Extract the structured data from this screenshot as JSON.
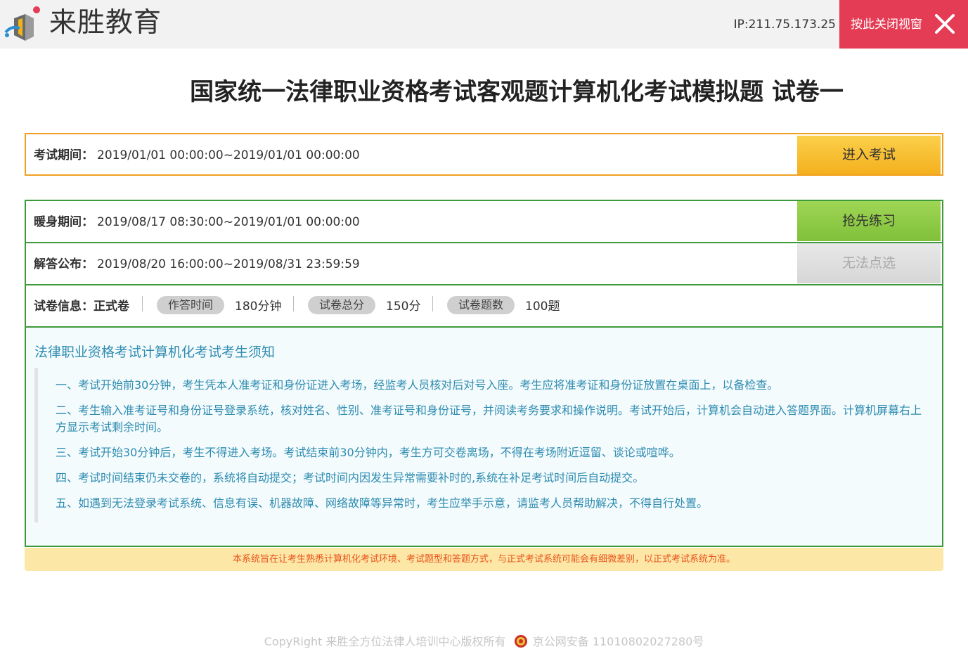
{
  "header": {
    "brand": "来胜教育",
    "ip": "IP:211.75.173.25",
    "close_label": "按此关闭视窗"
  },
  "title": "国家统一法律职业资格考试客观题计算机化考试模拟题 试卷一",
  "exam": {
    "label": "考试期间：",
    "value": "2019/01/01 00:00:00~2019/01/01 00:00:00",
    "button": "进入考试"
  },
  "warmup": {
    "label": "暖身期间：",
    "value": "2019/08/17 08:30:00~2019/01/01 00:00:00",
    "button": "抢先练习"
  },
  "answer": {
    "label": "解答公布：",
    "value": "2019/08/20 16:00:00~2019/08/31 23:59:59",
    "button": "无法点选"
  },
  "paper_info": {
    "label": "试卷信息：正式卷",
    "items": [
      {
        "tag": "作答时间",
        "value": "180分钟"
      },
      {
        "tag": "试卷总分",
        "value": "150分"
      },
      {
        "tag": "试卷题数",
        "value": "100题"
      }
    ]
  },
  "notice": {
    "title": "法律职业资格考试计算机化考试考生须知",
    "items": [
      "一、考试开始前30分钟，考生凭本人准考证和身份证进入考场，经监考人员核对后对号入座。考生应将准考证和身份证放置在桌面上，以备检查。",
      "二、考生输入准考证号和身份证号登录系统，核对姓名、性别、准考证号和身份证号，并阅读考务要求和操作说明。考试开始后，计算机会自动进入答题界面。计算机屏幕右上方显示考试剩余时间。",
      "三、考试开始30分钟后，考生不得进入考场。考试结束前30分钟内，考生方可交卷离场，不得在考场附近逗留、谈论或喧哗。",
      "四、考试时间结束仍未交卷的，系统将自动提交；考试时间内因发生异常需要补时的,系统在补足考试时间后自动提交。",
      "五、如遇到无法登录考试系统、信息有误、机器故障、网络故障等异常时，考生应举手示意，请监考人员帮助解决，不得自行处置。"
    ]
  },
  "disclaimer": "本系统旨在让考生熟悉计算机化考试环境、考试题型和答题方式，与正式考试系统可能会有细微差别，以正式考试系统为准。",
  "footer": {
    "copyright": "CopyRight 来胜全方位法律人培训中心版权所有",
    "beian": "京公网安备 11010802027280号"
  },
  "colors": {
    "close_button": "#e43c55",
    "exam_border": "#f0a020",
    "green_border": "#3d9a3a",
    "notice_text": "#2e8bb0",
    "disclaimer_text": "#e8541c"
  }
}
